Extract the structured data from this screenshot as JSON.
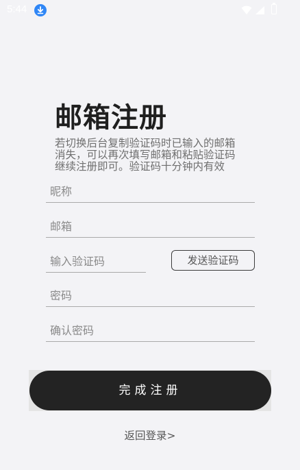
{
  "status_bar": {
    "time": "5:44",
    "icons": [
      "download-icon",
      "wifi-icon",
      "signal-icon",
      "battery-icon"
    ]
  },
  "register": {
    "title": "邮箱注册",
    "subtitle": "若切换后台复制验证码时已输入的邮箱消失，可以再次填写邮箱和粘贴验证码继续注册即可。验证码十分钟内有效",
    "fields": {
      "nickname_placeholder": "昵称",
      "email_placeholder": "邮箱",
      "code_placeholder": "输入验证码",
      "password_placeholder": "密码",
      "confirm_password_placeholder": "确认密码"
    },
    "send_code_label": "发送验证码",
    "submit_label": "完成注册",
    "back_login_label": "返回登录>"
  },
  "colors": {
    "background": "#f3f3f6",
    "button": "#232323",
    "accent": "#2f86f6"
  }
}
